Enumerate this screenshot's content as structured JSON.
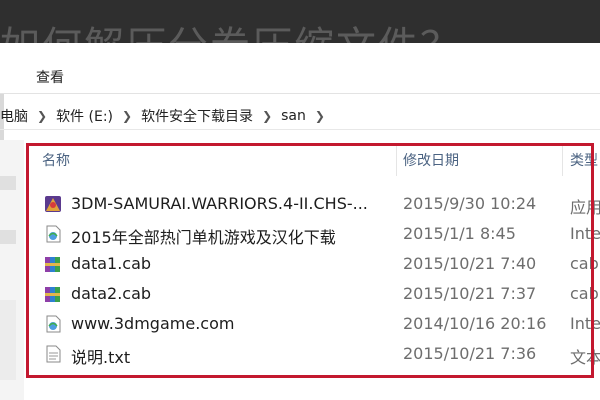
{
  "banner": {
    "text": "如何解压分卷压缩文件？"
  },
  "ribbon": {
    "tab_view": "查看"
  },
  "breadcrumb": [
    "此电脑",
    "软件 (E:)",
    "软件安全下载目录",
    "san"
  ],
  "columns": {
    "name": "名称",
    "modified": "修改日期",
    "type": "类型"
  },
  "files": [
    {
      "name": "3DM-SAMURAI.WARRIORS.4-II.CHS-...",
      "modified": "2015/9/30 10:24",
      "type": "应用",
      "icon": "game-app-icon"
    },
    {
      "name": "2015年全部热门单机游戏及汉化下载",
      "modified": "2015/1/1 8:45",
      "type": "Inte",
      "icon": "internet-shortcut-icon"
    },
    {
      "name": "data1.cab",
      "modified": "2015/10/21 7:40",
      "type": "cab",
      "icon": "winrar-archive-icon"
    },
    {
      "name": "data2.cab",
      "modified": "2015/10/21 7:37",
      "type": "cab",
      "icon": "winrar-archive-icon"
    },
    {
      "name": "www.3dmgame.com",
      "modified": "2014/10/16 20:16",
      "type": "Inte",
      "icon": "internet-shortcut-icon"
    },
    {
      "name": "说明.txt",
      "modified": "2015/10/21 7:36",
      "type": "文本",
      "icon": "text-file-icon"
    }
  ],
  "colors": {
    "highlight": "#c3182f",
    "header_text": "#4b6382"
  }
}
